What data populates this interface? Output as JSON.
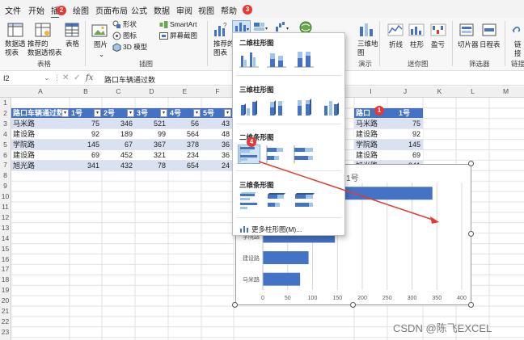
{
  "menu": {
    "items": [
      "文件",
      "开始",
      "插",
      "绘图",
      "页面布局",
      "公式",
      "数据",
      "审阅",
      "视图",
      "帮助"
    ],
    "badge_insert": "2"
  },
  "ribbon": {
    "pivot_table": "数据透\n视表",
    "recommended_pivot": "推荐的\n数据透视表",
    "table": "表格",
    "tables_group": "表格",
    "pictures": "图片",
    "shapes": "形状",
    "icons": "图标",
    "model3d": "3D 模型",
    "smartart": "SmartArt",
    "screenshot": "屏幕截图",
    "illustrations_group": "插图",
    "recommended_charts": "推荐的\n图表",
    "badge_chart": "3",
    "map3d": "三维地\n图",
    "tours_group": "演示",
    "line": "折线",
    "column": "柱形",
    "winloss": "盈亏",
    "sparklines_group": "迷你图",
    "slicer": "切片器",
    "timeline": "日程表",
    "filters_group": "筛选器",
    "link": "链\n接",
    "links_group": "链接"
  },
  "formula_bar": {
    "name_box": "I2",
    "fx": "fx",
    "formula": "路口车辆通过数"
  },
  "columns": [
    "A",
    "B",
    "C",
    "D",
    "E",
    "F",
    "I",
    "J",
    "K",
    "L",
    "M"
  ],
  "rows": [
    "1",
    "2",
    "3",
    "4",
    "5",
    "6",
    "7",
    "8",
    "9",
    "10",
    "11",
    "12",
    "13",
    "14",
    "15",
    "16",
    "17",
    "18",
    "19",
    "20",
    "21",
    "22",
    "23"
  ],
  "table": {
    "header": [
      "路口车辆通过数",
      "1号",
      "2号",
      "3号",
      "4号",
      "5号"
    ],
    "header_tail": "43",
    "body": [
      [
        "马米路",
        "75",
        "346",
        "521",
        "56",
        "43"
      ],
      [
        "建设路",
        "92",
        "189",
        "99",
        "564",
        "48"
      ],
      [
        "学院路",
        "145",
        "67",
        "367",
        "378",
        "36"
      ],
      [
        "建设路",
        "69",
        "452",
        "321",
        "234",
        "36"
      ],
      [
        "旭光路",
        "341",
        "432",
        "78",
        "654",
        "24"
      ]
    ]
  },
  "table2": {
    "header": [
      "路口",
      "1号"
    ],
    "badge": "1",
    "body": [
      [
        "马米路",
        "75"
      ],
      [
        "建设路",
        "92"
      ],
      [
        "学院路",
        "145"
      ],
      [
        "建设路",
        "69"
      ],
      [
        "旭光路",
        "341"
      ]
    ]
  },
  "dropdown": {
    "section_2d_column": "二维柱形图",
    "section_3d_column": "三维柱形图",
    "section_2d_bar": "二维条形图",
    "section_3d_bar": "三维条形图",
    "badge_bar": "4",
    "more": "更多柱形图(M)..."
  },
  "chart_data": {
    "type": "bar",
    "orientation": "horizontal",
    "title": "1号",
    "categories": [
      "马米路",
      "建设路",
      "学院路",
      "建设路",
      "旭光路"
    ],
    "values": [
      75,
      92,
      145,
      69,
      341
    ],
    "xlim": [
      0,
      400
    ],
    "xticks": [
      "0",
      "50",
      "100",
      "150",
      "200",
      "250",
      "300",
      "350",
      "400"
    ],
    "grid": true,
    "bar_color": "#4472c4"
  },
  "watermark": "CSDN @陈飞EXCEL",
  "colors": {
    "accent_green": "#217346",
    "table_header": "#4472c4",
    "band_light": "#d9e1f2",
    "badge_red": "#e53935",
    "arrow_red": "#e53935"
  }
}
